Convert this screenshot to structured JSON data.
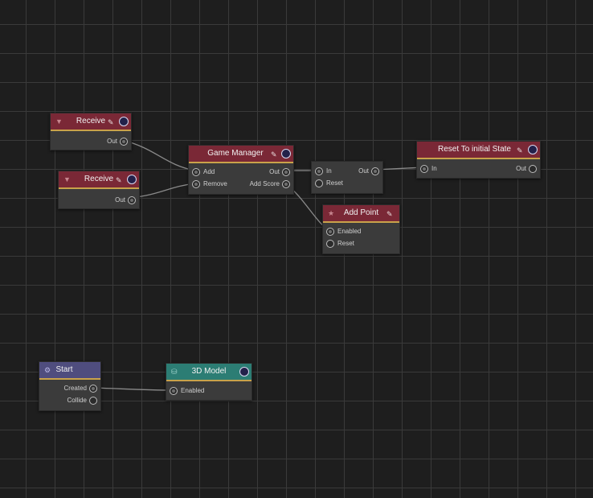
{
  "colors": {
    "canvas": "#1e1e1e",
    "grid": "#3a3a3a",
    "node_body": "#3b3b3b",
    "event_header": "#7a2836",
    "model_header": "#2c7d74",
    "start_header": "#4f4d7e",
    "header_accent": "#c9a24a"
  },
  "icons": {
    "receive": "chevron-down-icon",
    "pin": "pin-icon",
    "add_point": "star-icon",
    "start": "gear-icon",
    "model": "cube-icon",
    "output_port": "circle-port-icon"
  },
  "nodes": {
    "receive1": {
      "title": "Receive",
      "out": "Out"
    },
    "receive2": {
      "title": "Receive",
      "out": "Out"
    },
    "game_manager": {
      "title": "Game Manager",
      "in_add": "Add",
      "in_remove": "Remove",
      "out_out": "Out",
      "out_add_score": "Add Score"
    },
    "relay": {
      "in": "In",
      "reset": "Reset",
      "out": "Out"
    },
    "reset_initial": {
      "title": "Reset To initial State",
      "in": "In",
      "out": "Out"
    },
    "add_point": {
      "title": "Add Point",
      "enabled": "Enabled",
      "reset": "Reset"
    },
    "start": {
      "title": "Start",
      "created": "Created",
      "collide": "Collide"
    },
    "model3d": {
      "title": "3D Model",
      "enabled": "Enabled"
    }
  }
}
